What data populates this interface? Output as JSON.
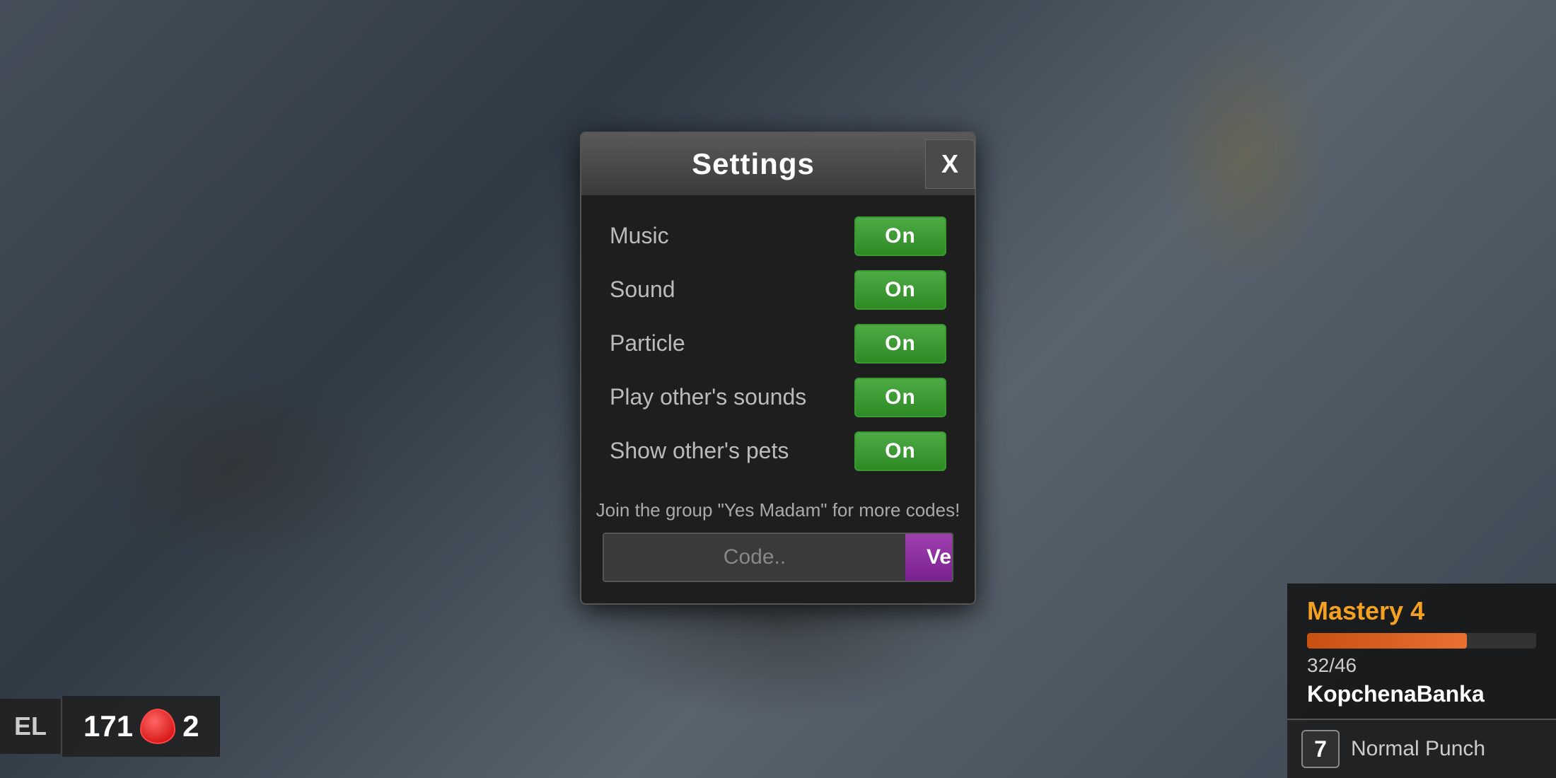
{
  "background": {
    "color": "#5a6a7a"
  },
  "hud": {
    "level_tag": "EL",
    "coins": "171",
    "gem_count": "2",
    "mastery_title": "Mastery 4",
    "mastery_current": "32",
    "mastery_max": "46",
    "mastery_percent": 69.6,
    "player_name": "KopchenaBanka",
    "action_key": "7",
    "action_label": "Normal Punch"
  },
  "settings": {
    "title": "Settings",
    "close_label": "X",
    "rows": [
      {
        "label": "Music",
        "value": "On"
      },
      {
        "label": "Sound",
        "value": "On"
      },
      {
        "label": "Particle",
        "value": "On"
      },
      {
        "label": "Play other's sounds",
        "value": "On"
      },
      {
        "label": "Show other's pets",
        "value": "On"
      }
    ],
    "join_text": "Join the group \"Yes Madam\" for more codes!",
    "code_placeholder": "Code..",
    "verify_label": "Verify"
  }
}
